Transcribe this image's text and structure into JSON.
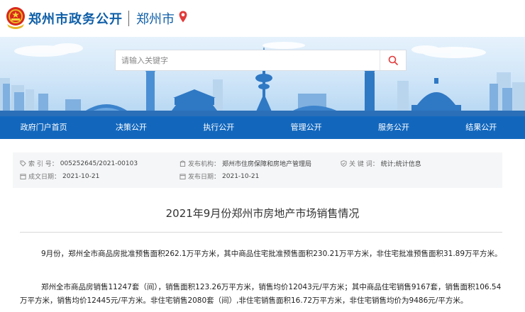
{
  "header": {
    "site_name": "郑州市政务公开",
    "city": "郑州市"
  },
  "search": {
    "placeholder": "请输入关键字"
  },
  "nav": {
    "items": [
      "政府门户首页",
      "决策公开",
      "执行公开",
      "管理公开",
      "服务公开",
      "结果公开"
    ]
  },
  "meta": {
    "index_key": "索 引 号：",
    "index_val": "005252645/2021-00103",
    "org_key": "发布机构：",
    "org_val": "郑州市住房保障和房地产管理局",
    "keyword_key": "关 键 词：",
    "keyword_val": "统计;统计信息",
    "created_key": "成文日期：",
    "created_val": "2021-10-21",
    "published_key": "发布日期：",
    "published_val": "2021-10-21"
  },
  "article": {
    "title": "2021年9月份郑州市房地产市场销售情况",
    "paragraphs": [
      "9月份，郑州全市商品房批准预售面积262.1万平方米，其中商品住宅批准预售面积230.21万平方米，非住宅批准预售面积31.89万平方米。",
      "郑州全市商品房销售11247套（间），销售面积123.26万平方米，销售均价12043元/平方米；其中商品住宅销售9167套，销售面积106.54万平方米，销售均价12445元/平方米。非住宅销售2080套（间）,非住宅销售面积16.72万平方米，非住宅销售均价为9486元/平方米。"
    ]
  },
  "colors": {
    "brand_blue": "#0f5fa8",
    "nav_blue": "#1267bd",
    "pin_red": "#e23a3a"
  }
}
